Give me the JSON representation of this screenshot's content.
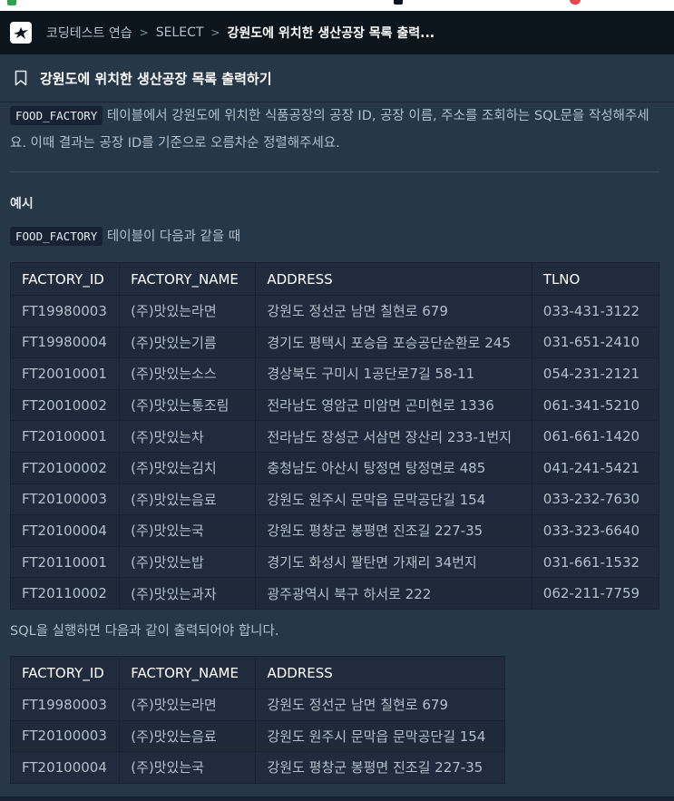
{
  "navbar": {
    "breadcrumbs": [
      "코딩테스트 연습",
      "SELECT",
      "강원도에 위치한 생산공장 목록 출력..."
    ]
  },
  "problem": {
    "title": "강원도에 위치한 생산공장 목록 출력하기",
    "table_name": "FOOD_FACTORY",
    "description": "테이블에서 강원도에 위치한 식품공장의 공장 ID, 공장 이름, 주소를 조회하는 SQL문을 작성해주세요. 이때 결과는 공장 ID를 기준으로 오름차순 정렬해주세요.",
    "example_heading": "예시",
    "example_caption": "테이블이 다음과 같을 때",
    "result_caption": "SQL을 실행하면 다음과 같이 출력되어야 합니다."
  },
  "input_table": {
    "headers": [
      "FACTORY_ID",
      "FACTORY_NAME",
      "ADDRESS",
      "TLNO"
    ],
    "rows": [
      [
        "FT19980003",
        "(주)맛있는라면",
        "강원도 정선군 남면 칠현로 679",
        "033-431-3122"
      ],
      [
        "FT19980004",
        "(주)맛있는기름",
        "경기도 평택시 포승읍 포승공단순환로 245",
        "031-651-2410"
      ],
      [
        "FT20010001",
        "(주)맛있는소스",
        "경상북도 구미시 1공단로7길 58-11",
        "054-231-2121"
      ],
      [
        "FT20010002",
        "(주)맛있는통조림",
        "전라남도 영암군 미암면 곤미현로 1336",
        "061-341-5210"
      ],
      [
        "FT20100001",
        "(주)맛있는차",
        "전라남도 장성군 서삼면 장산리 233-1번지",
        "061-661-1420"
      ],
      [
        "FT20100002",
        "(주)맛있는김치",
        "충청남도 아산시 탕정면 탕정면로 485",
        "041-241-5421"
      ],
      [
        "FT20100003",
        "(주)맛있는음료",
        "강원도 원주시 문막읍 문막공단길 154",
        "033-232-7630"
      ],
      [
        "FT20100004",
        "(주)맛있는국",
        "강원도 평창군 봉평면 진조길 227-35",
        "033-323-6640"
      ],
      [
        "FT20110001",
        "(주)맛있는밥",
        "경기도 화성시 팔탄면 가재리 34번지",
        "031-661-1532"
      ],
      [
        "FT20110002",
        "(주)맛있는과자",
        "광주광역시 북구 하서로 222",
        "062-211-7759"
      ]
    ]
  },
  "output_table": {
    "headers": [
      "FACTORY_ID",
      "FACTORY_NAME",
      "ADDRESS"
    ],
    "rows": [
      [
        "FT19980003",
        "(주)맛있는라면",
        "강원도 정선군 남면 칠현로 679"
      ],
      [
        "FT20100003",
        "(주)맛있는음료",
        "강원도 원주시 문막읍 문막공단길 154"
      ],
      [
        "FT20100004",
        "(주)맛있는국",
        "강원도 평창군 봉평면 진조길 227-35"
      ]
    ]
  }
}
